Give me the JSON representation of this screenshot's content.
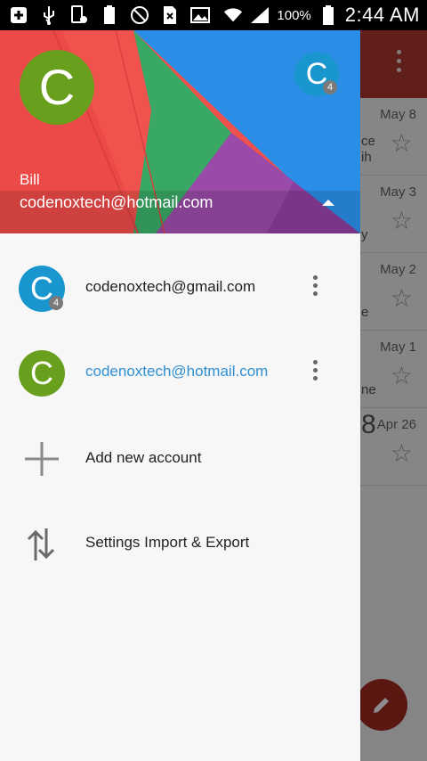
{
  "status_bar": {
    "battery_percent": "100%",
    "time": "2:44 AM"
  },
  "background_list": {
    "items": [
      {
        "date": "May 8",
        "fragment_top": "ce",
        "fragment_bottom": "ih"
      },
      {
        "date": "May 3",
        "fragment_top": "",
        "fragment_bottom": "y"
      },
      {
        "date": "May 2",
        "fragment_top": "",
        "fragment_bottom": "e"
      },
      {
        "date": "May 1",
        "fragment_top": "",
        "fragment_bottom": "ne"
      },
      {
        "date": "Apr 26",
        "fragment_top": "8",
        "fragment_bottom": ""
      }
    ]
  },
  "drawer": {
    "header": {
      "avatar_letter": "C",
      "secondary_avatar_letter": "C",
      "secondary_badge": "4",
      "name": "Bill",
      "email": "codenoxtech@hotmail.com"
    },
    "accounts": [
      {
        "letter": "C",
        "badge": "4",
        "email": "codenoxtech@gmail.com",
        "color": "#1a96cf",
        "email_color": "#222222"
      },
      {
        "letter": "C",
        "badge": "",
        "email": "codenoxtech@hotmail.com",
        "color": "#689f1d",
        "email_color": "#2f8fd2"
      }
    ],
    "actions": [
      {
        "icon": "plus-icon",
        "label": "Add new account"
      },
      {
        "icon": "import-export-icon",
        "label": "Settings Import & Export"
      }
    ]
  }
}
